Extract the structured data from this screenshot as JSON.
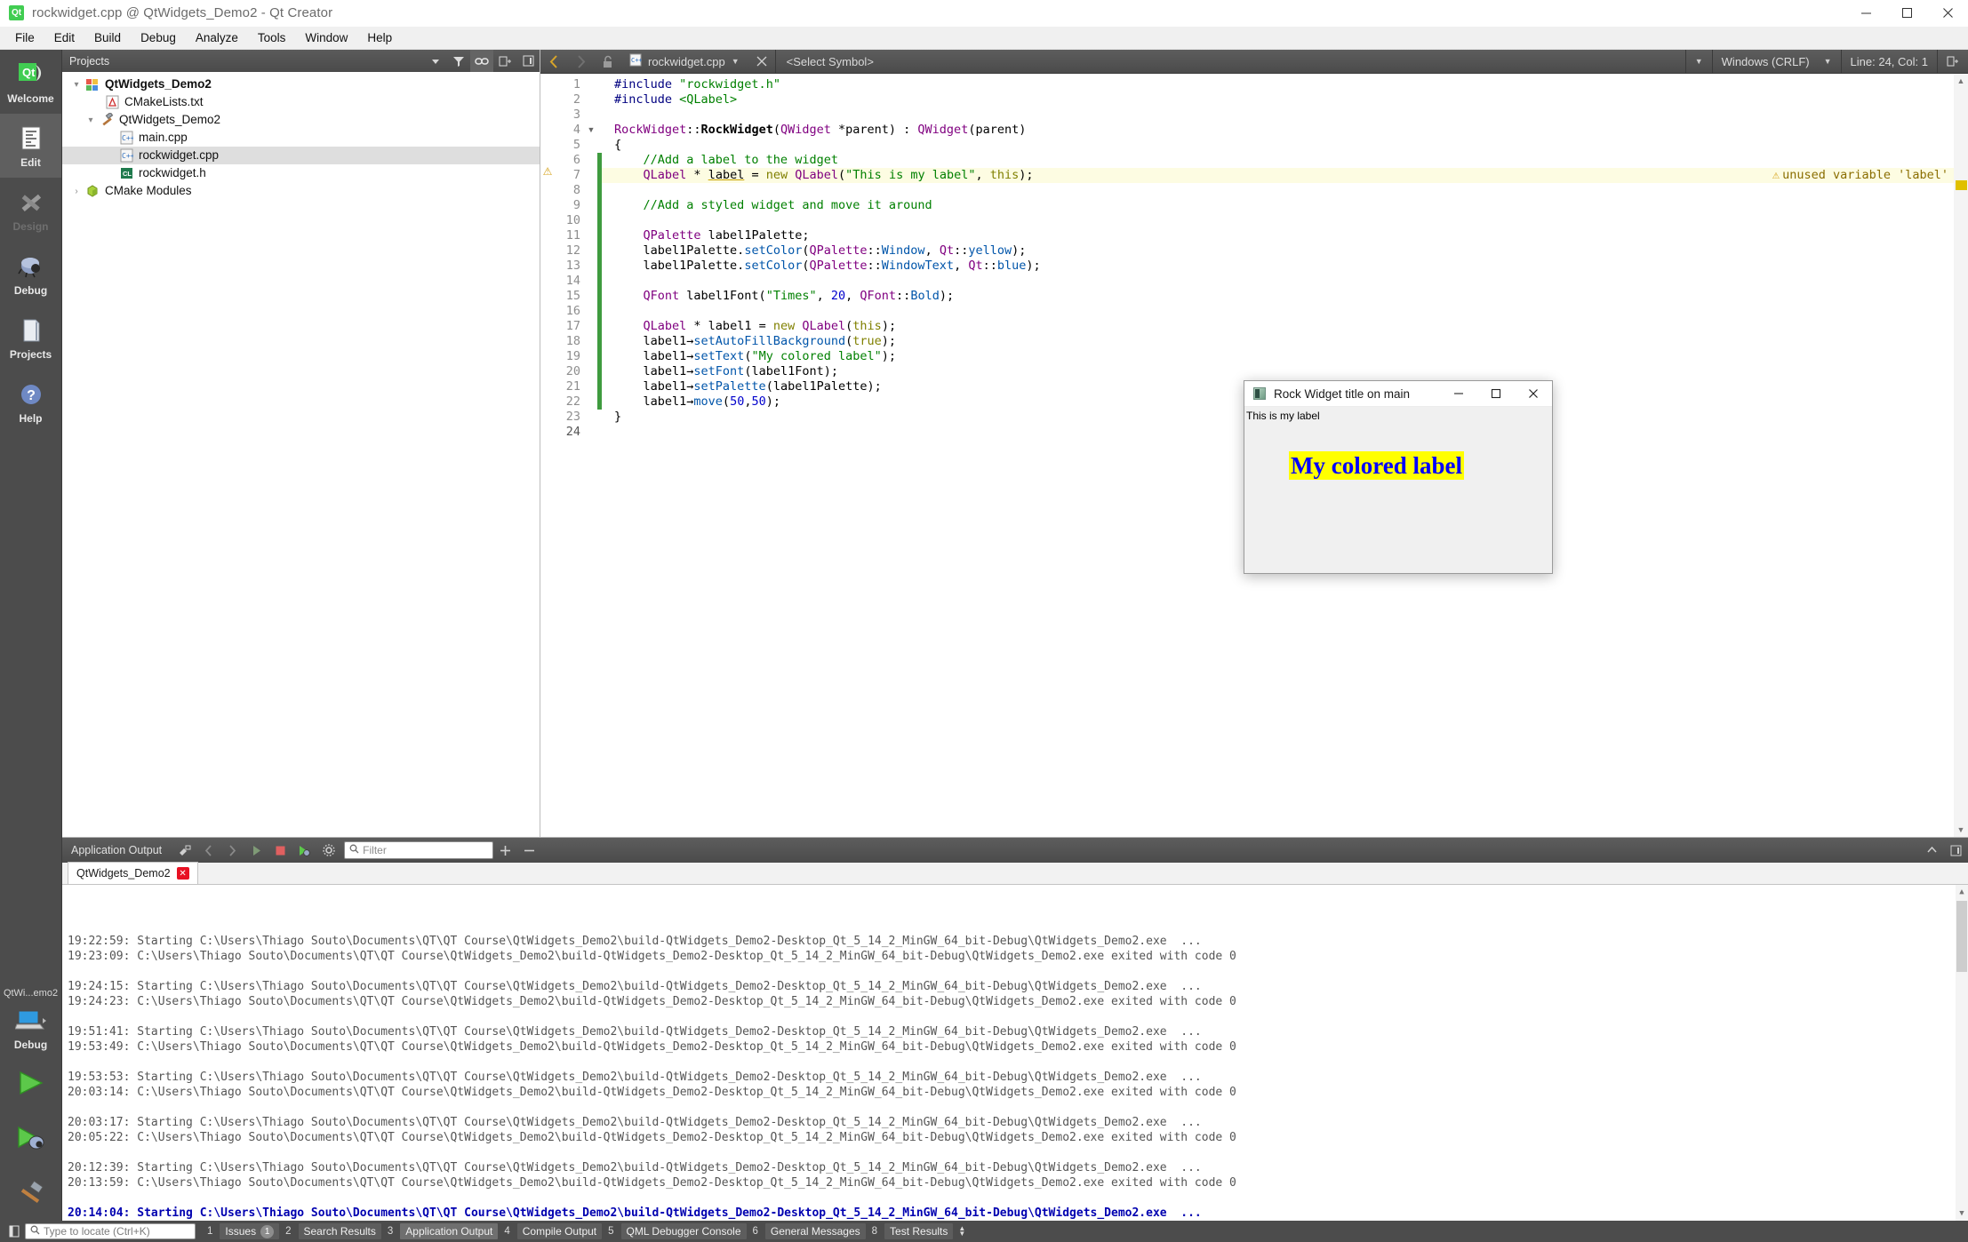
{
  "window": {
    "title": "rockwidget.cpp @ QtWidgets_Demo2 - Qt Creator",
    "app_icon": "qt-logo-icon",
    "minimize": "minimize-icon",
    "maximize": "maximize-icon",
    "close": "close-icon"
  },
  "menubar": {
    "items": [
      "File",
      "Edit",
      "Build",
      "Debug",
      "Analyze",
      "Tools",
      "Window",
      "Help"
    ]
  },
  "modebar": {
    "items": [
      {
        "label": "Welcome",
        "icon": "qt-welcome-icon",
        "state": "normal"
      },
      {
        "label": "Edit",
        "icon": "document-edit-icon",
        "state": "active"
      },
      {
        "label": "Design",
        "icon": "brush-ruler-icon",
        "state": "disabled"
      },
      {
        "label": "Debug",
        "icon": "bug-icon",
        "state": "normal"
      },
      {
        "label": "Projects",
        "icon": "folder-icon",
        "state": "normal"
      },
      {
        "label": "Help",
        "icon": "question-mark-icon",
        "state": "normal"
      }
    ],
    "kit_label": "QtWi...emo2",
    "kit_mode": "Debug",
    "kit_icon": "computer-icon",
    "run_button": "run-green-triangle-icon",
    "debug_button": "run-debug-icon",
    "build_button": "build-hammer-icon"
  },
  "projects_panel": {
    "title": "Projects",
    "toolbar": [
      "filter-icon",
      "link-sync-icon",
      "split-icon",
      "close-panel-icon"
    ],
    "tree": [
      {
        "label": "QtWidgets_Demo2",
        "icon": "project-icon",
        "indent": 0,
        "expander": "expanded",
        "bold": true,
        "selected": false
      },
      {
        "label": "CMakeLists.txt",
        "icon": "cmake-file-icon",
        "indent": 1,
        "expander": "none",
        "bold": false,
        "selected": false
      },
      {
        "label": "QtWidgets_Demo2",
        "icon": "build-target-icon",
        "indent": 1,
        "expander": "expanded",
        "bold": false,
        "selected": false
      },
      {
        "label": "main.cpp",
        "icon": "cpp-file-icon",
        "indent": 2,
        "expander": "none",
        "bold": false,
        "selected": false
      },
      {
        "label": "rockwidget.cpp",
        "icon": "cpp-file-icon",
        "indent": 2,
        "expander": "none",
        "bold": false,
        "selected": true
      },
      {
        "label": "rockwidget.h",
        "icon": "header-file-icon",
        "indent": 2,
        "expander": "none",
        "bold": false,
        "selected": false
      },
      {
        "label": "CMake Modules",
        "icon": "cmake-modules-icon",
        "indent": 0,
        "expander": "collapsed",
        "bold": false,
        "selected": false
      }
    ]
  },
  "editor_toolbar": {
    "back": "back-arrow-icon",
    "forward": "forward-arrow-icon",
    "lock": "unlocked-padlock-icon",
    "file_icon": "cpp-file-icon",
    "filename": "rockwidget.cpp",
    "close_file": "close-icon",
    "symbol_selector": "<Select Symbol>",
    "line_ending": "Windows (CRLF)",
    "cursor_position": "Line: 24, Col: 1",
    "split_button": "split-editor-icon"
  },
  "code": {
    "warning_text": "unused variable 'label'",
    "warning_line": 7,
    "lines": [
      {
        "n": 1,
        "segments": [
          {
            "t": "#include ",
            "c": "pre"
          },
          {
            "t": "\"rockwidget.h\"",
            "c": "str"
          }
        ]
      },
      {
        "n": 2,
        "segments": [
          {
            "t": "#include ",
            "c": "pre"
          },
          {
            "t": "<QLabel>",
            "c": "str"
          }
        ]
      },
      {
        "n": 3,
        "segments": []
      },
      {
        "n": 4,
        "segments": [
          {
            "t": "RockWidget",
            "c": "type"
          },
          {
            "t": "::",
            "c": "plain"
          },
          {
            "t": "RockWidget",
            "c": "ctor"
          },
          {
            "t": "(",
            "c": "plain"
          },
          {
            "t": "QWidget",
            "c": "type"
          },
          {
            "t": " *parent) : ",
            "c": "plain"
          },
          {
            "t": "QWidget",
            "c": "type"
          },
          {
            "t": "(parent)",
            "c": "plain"
          }
        ]
      },
      {
        "n": 5,
        "segments": [
          {
            "t": "{",
            "c": "plain"
          }
        ]
      },
      {
        "n": 6,
        "segments": [
          {
            "t": "    //Add a label to the widget",
            "c": "com"
          }
        ]
      },
      {
        "n": 7,
        "segments": [
          {
            "t": "    ",
            "c": "plain"
          },
          {
            "t": "QLabel",
            "c": "type"
          },
          {
            "t": " * ",
            "c": "plain"
          },
          {
            "t": "label",
            "c": "unused"
          },
          {
            "t": " = ",
            "c": "plain"
          },
          {
            "t": "new",
            "c": "key"
          },
          {
            "t": " ",
            "c": "plain"
          },
          {
            "t": "QLabel",
            "c": "type"
          },
          {
            "t": "(",
            "c": "plain"
          },
          {
            "t": "\"This is my label\"",
            "c": "str"
          },
          {
            "t": ", ",
            "c": "plain"
          },
          {
            "t": "this",
            "c": "key"
          },
          {
            "t": ");",
            "c": "plain"
          }
        ]
      },
      {
        "n": 8,
        "segments": []
      },
      {
        "n": 9,
        "segments": [
          {
            "t": "    //Add a styled widget and move it around",
            "c": "com"
          }
        ]
      },
      {
        "n": 10,
        "segments": []
      },
      {
        "n": 11,
        "segments": [
          {
            "t": "    ",
            "c": "plain"
          },
          {
            "t": "QPalette",
            "c": "type"
          },
          {
            "t": " label1Palette;",
            "c": "plain"
          }
        ]
      },
      {
        "n": 12,
        "segments": [
          {
            "t": "    label1Palette.",
            "c": "plain"
          },
          {
            "t": "setColor",
            "c": "fn"
          },
          {
            "t": "(",
            "c": "plain"
          },
          {
            "t": "QPalette",
            "c": "type"
          },
          {
            "t": "::",
            "c": "plain"
          },
          {
            "t": "Window",
            "c": "fn"
          },
          {
            "t": ", ",
            "c": "plain"
          },
          {
            "t": "Qt",
            "c": "type"
          },
          {
            "t": "::",
            "c": "plain"
          },
          {
            "t": "yellow",
            "c": "fn"
          },
          {
            "t": ");",
            "c": "plain"
          }
        ]
      },
      {
        "n": 13,
        "segments": [
          {
            "t": "    label1Palette.",
            "c": "plain"
          },
          {
            "t": "setColor",
            "c": "fn"
          },
          {
            "t": "(",
            "c": "plain"
          },
          {
            "t": "QPalette",
            "c": "type"
          },
          {
            "t": "::",
            "c": "plain"
          },
          {
            "t": "WindowText",
            "c": "fn"
          },
          {
            "t": ", ",
            "c": "plain"
          },
          {
            "t": "Qt",
            "c": "type"
          },
          {
            "t": "::",
            "c": "plain"
          },
          {
            "t": "blue",
            "c": "fn"
          },
          {
            "t": ");",
            "c": "plain"
          }
        ]
      },
      {
        "n": 14,
        "segments": []
      },
      {
        "n": 15,
        "segments": [
          {
            "t": "    ",
            "c": "plain"
          },
          {
            "t": "QFont",
            "c": "type"
          },
          {
            "t": " label1Font(",
            "c": "plain"
          },
          {
            "t": "\"Times\"",
            "c": "str"
          },
          {
            "t": ", ",
            "c": "plain"
          },
          {
            "t": "20",
            "c": "num"
          },
          {
            "t": ", ",
            "c": "plain"
          },
          {
            "t": "QFont",
            "c": "type"
          },
          {
            "t": "::",
            "c": "plain"
          },
          {
            "t": "Bold",
            "c": "fn"
          },
          {
            "t": ");",
            "c": "plain"
          }
        ]
      },
      {
        "n": 16,
        "segments": []
      },
      {
        "n": 17,
        "segments": [
          {
            "t": "    ",
            "c": "plain"
          },
          {
            "t": "QLabel",
            "c": "type"
          },
          {
            "t": " * label1 = ",
            "c": "plain"
          },
          {
            "t": "new",
            "c": "key"
          },
          {
            "t": " ",
            "c": "plain"
          },
          {
            "t": "QLabel",
            "c": "type"
          },
          {
            "t": "(",
            "c": "plain"
          },
          {
            "t": "this",
            "c": "key"
          },
          {
            "t": ");",
            "c": "plain"
          }
        ]
      },
      {
        "n": 18,
        "segments": [
          {
            "t": "    label1→",
            "c": "plain"
          },
          {
            "t": "setAutoFillBackground",
            "c": "fn"
          },
          {
            "t": "(",
            "c": "plain"
          },
          {
            "t": "true",
            "c": "key"
          },
          {
            "t": ");",
            "c": "plain"
          }
        ]
      },
      {
        "n": 19,
        "segments": [
          {
            "t": "    label1→",
            "c": "plain"
          },
          {
            "t": "setText",
            "c": "fn"
          },
          {
            "t": "(",
            "c": "plain"
          },
          {
            "t": "\"My colored label\"",
            "c": "str"
          },
          {
            "t": ");",
            "c": "plain"
          }
        ]
      },
      {
        "n": 20,
        "segments": [
          {
            "t": "    label1→",
            "c": "plain"
          },
          {
            "t": "setFont",
            "c": "fn"
          },
          {
            "t": "(label1Font);",
            "c": "plain"
          }
        ]
      },
      {
        "n": 21,
        "segments": [
          {
            "t": "    label1→",
            "c": "plain"
          },
          {
            "t": "setPalette",
            "c": "fn"
          },
          {
            "t": "(label1Palette);",
            "c": "plain"
          }
        ]
      },
      {
        "n": 22,
        "segments": [
          {
            "t": "    label1→",
            "c": "plain"
          },
          {
            "t": "move",
            "c": "fn"
          },
          {
            "t": "(",
            "c": "plain"
          },
          {
            "t": "50",
            "c": "num"
          },
          {
            "t": ",",
            "c": "plain"
          },
          {
            "t": "50",
            "c": "num"
          },
          {
            "t": ");",
            "c": "plain"
          }
        ]
      },
      {
        "n": 23,
        "segments": [
          {
            "t": "}",
            "c": "plain"
          }
        ]
      },
      {
        "n": 24,
        "segments": []
      }
    ]
  },
  "rock_window": {
    "title": "Rock Widget title on main",
    "icon": "app-window-icon",
    "minimize": "minimize-icon",
    "maximize": "maximize-icon",
    "close": "close-icon",
    "label_plain": "This is my label",
    "label_colored": "My colored label",
    "label_colored_bg": "#ffff00",
    "label_colored_fg": "#0000ff"
  },
  "output_pane": {
    "title": "Application Output",
    "toolbar_icons": [
      "clear-output-icon",
      "prev-item-icon",
      "next-item-icon",
      "run-icon",
      "stop-icon",
      "attach-debugger-icon",
      "settings-gear-icon"
    ],
    "filter_placeholder": "Filter",
    "zoom_in": "plus-icon",
    "zoom_out": "minus-icon",
    "maximize": "maximize-pane-icon",
    "close": "close-pane-icon",
    "tab_label": "QtWidgets_Demo2",
    "tab_close": "close-tab-icon",
    "lines": [
      {
        "text": "19:22:59: Starting C:\\Users\\Thiago Souto\\Documents\\QT\\QT Course\\QtWidgets_Demo2\\build-QtWidgets_Demo2-Desktop_Qt_5_14_2_MinGW_64_bit-Debug\\QtWidgets_Demo2.exe  ...",
        "current": false
      },
      {
        "text": "19:23:09: C:\\Users\\Thiago Souto\\Documents\\QT\\QT Course\\QtWidgets_Demo2\\build-QtWidgets_Demo2-Desktop_Qt_5_14_2_MinGW_64_bit-Debug\\QtWidgets_Demo2.exe exited with code 0",
        "current": false
      },
      {
        "text": "",
        "current": false
      },
      {
        "text": "19:24:15: Starting C:\\Users\\Thiago Souto\\Documents\\QT\\QT Course\\QtWidgets_Demo2\\build-QtWidgets_Demo2-Desktop_Qt_5_14_2_MinGW_64_bit-Debug\\QtWidgets_Demo2.exe  ...",
        "current": false
      },
      {
        "text": "19:24:23: C:\\Users\\Thiago Souto\\Documents\\QT\\QT Course\\QtWidgets_Demo2\\build-QtWidgets_Demo2-Desktop_Qt_5_14_2_MinGW_64_bit-Debug\\QtWidgets_Demo2.exe exited with code 0",
        "current": false
      },
      {
        "text": "",
        "current": false
      },
      {
        "text": "19:51:41: Starting C:\\Users\\Thiago Souto\\Documents\\QT\\QT Course\\QtWidgets_Demo2\\build-QtWidgets_Demo2-Desktop_Qt_5_14_2_MinGW_64_bit-Debug\\QtWidgets_Demo2.exe  ...",
        "current": false
      },
      {
        "text": "19:53:49: C:\\Users\\Thiago Souto\\Documents\\QT\\QT Course\\QtWidgets_Demo2\\build-QtWidgets_Demo2-Desktop_Qt_5_14_2_MinGW_64_bit-Debug\\QtWidgets_Demo2.exe exited with code 0",
        "current": false
      },
      {
        "text": "",
        "current": false
      },
      {
        "text": "19:53:53: Starting C:\\Users\\Thiago Souto\\Documents\\QT\\QT Course\\QtWidgets_Demo2\\build-QtWidgets_Demo2-Desktop_Qt_5_14_2_MinGW_64_bit-Debug\\QtWidgets_Demo2.exe  ...",
        "current": false
      },
      {
        "text": "20:03:14: C:\\Users\\Thiago Souto\\Documents\\QT\\QT Course\\QtWidgets_Demo2\\build-QtWidgets_Demo2-Desktop_Qt_5_14_2_MinGW_64_bit-Debug\\QtWidgets_Demo2.exe exited with code 0",
        "current": false
      },
      {
        "text": "",
        "current": false
      },
      {
        "text": "20:03:17: Starting C:\\Users\\Thiago Souto\\Documents\\QT\\QT Course\\QtWidgets_Demo2\\build-QtWidgets_Demo2-Desktop_Qt_5_14_2_MinGW_64_bit-Debug\\QtWidgets_Demo2.exe  ...",
        "current": false
      },
      {
        "text": "20:05:22: C:\\Users\\Thiago Souto\\Documents\\QT\\QT Course\\QtWidgets_Demo2\\build-QtWidgets_Demo2-Desktop_Qt_5_14_2_MinGW_64_bit-Debug\\QtWidgets_Demo2.exe exited with code 0",
        "current": false
      },
      {
        "text": "",
        "current": false
      },
      {
        "text": "20:12:39: Starting C:\\Users\\Thiago Souto\\Documents\\QT\\QT Course\\QtWidgets_Demo2\\build-QtWidgets_Demo2-Desktop_Qt_5_14_2_MinGW_64_bit-Debug\\QtWidgets_Demo2.exe  ...",
        "current": false
      },
      {
        "text": "20:13:59: C:\\Users\\Thiago Souto\\Documents\\QT\\QT Course\\QtWidgets_Demo2\\build-QtWidgets_Demo2-Desktop_Qt_5_14_2_MinGW_64_bit-Debug\\QtWidgets_Demo2.exe exited with code 0",
        "current": false
      },
      {
        "text": "",
        "current": false
      },
      {
        "text": "20:14:04: Starting C:\\Users\\Thiago Souto\\Documents\\QT\\QT Course\\QtWidgets_Demo2\\build-QtWidgets_Demo2-Desktop_Qt_5_14_2_MinGW_64_bit-Debug\\QtWidgets_Demo2.exe  ...",
        "current": true
      }
    ]
  },
  "statusbar": {
    "sidebar_toggle": "toggle-sidebar-icon",
    "locate_placeholder": "Type to locate (Ctrl+K)",
    "tabs": [
      {
        "num": "1",
        "label": "Issues",
        "badge": "1",
        "selected": false
      },
      {
        "num": "2",
        "label": "Search Results",
        "badge": "",
        "selected": false
      },
      {
        "num": "3",
        "label": "Application Output",
        "badge": "",
        "selected": true
      },
      {
        "num": "4",
        "label": "Compile Output",
        "badge": "",
        "selected": false
      },
      {
        "num": "5",
        "label": "QML Debugger Console",
        "badge": "",
        "selected": false
      },
      {
        "num": "6",
        "label": "General Messages",
        "badge": "",
        "selected": false
      },
      {
        "num": "8",
        "label": "Test Results",
        "badge": "",
        "selected": false
      }
    ]
  }
}
